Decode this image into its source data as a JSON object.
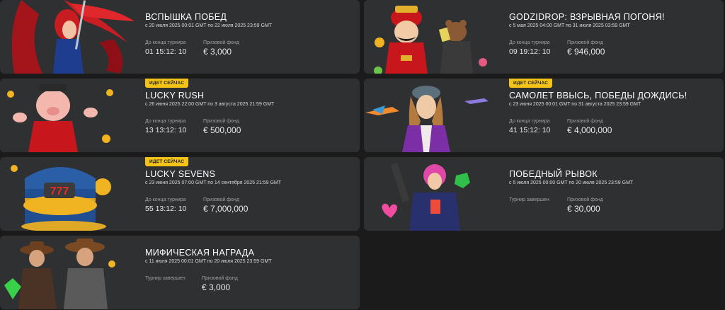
{
  "live_badge": "ИДЕТ СЕЙЧАС",
  "labels": {
    "time_left": "До конца турнира",
    "prize_pool": "Призовой фонд"
  },
  "tournaments": [
    {
      "title": "ВСПЫШКА ПОБЕД",
      "dates": "с 20 июля 2025 00:01 GMT по 22 июля 2025 23:59 GMT",
      "status": "01 15:12: 10",
      "prize": "€ 3,000",
      "art": "red-haired-warrior-image"
    },
    {
      "title": "GODZIDROP: ВЗРЫВНАЯ ПОГОНЯ!",
      "dates": "с 5 мая 2025 04:00 GMT по 31 июля 2025 03:59 GMT",
      "status": "09 19:12: 10",
      "prize": "€ 946,000",
      "art": "fortune-god-and-bear-image"
    },
    {
      "title": "LUCKY RUSH",
      "dates": "с 26 июня 2025 22:00 GMT по 3 августа 2025 21:59 GMT",
      "status": "13 13:12: 10",
      "prize": "€ 500,000",
      "art": "lucky-pig-image"
    },
    {
      "title": "САМОЛЕТ ВВЫСЬ, ПОБЕДЫ ДОЖДИСЬ!",
      "dates": "с 23 июня 2025 00:01 GMT по 31 августа 2025 23:59 GMT",
      "status": "41 15:12: 10",
      "prize": "€ 4,000,000",
      "art": "pilot-woman-image"
    },
    {
      "title": "LUCKY SEVENS",
      "dates": "с 23 июня 2025 07:00 GMT по 14 сентября 2025 21:59 GMT",
      "status": "55 13:12: 10",
      "prize": "€ 7,000,000",
      "art": "treasure-chest-777-image"
    },
    {
      "title": "ПОБЕДНЫЙ РЫВОК",
      "dates": "с 5 июля 2025 00:00 GMT по 20 июля 2025 23:59 GMT",
      "status_label": "Турнир завершен",
      "prize": "€ 30,000",
      "art": "pink-hair-gamer-image"
    },
    {
      "title": "МИФИЧЕСКАЯ НАГРАДА",
      "dates": "с 11 июля 2025 00:01 GMT по 20 июля 2025 23:59 GMT",
      "status_label": "Турнир завершен",
      "prize": "€ 3,000",
      "art": "cowboys-image"
    }
  ]
}
